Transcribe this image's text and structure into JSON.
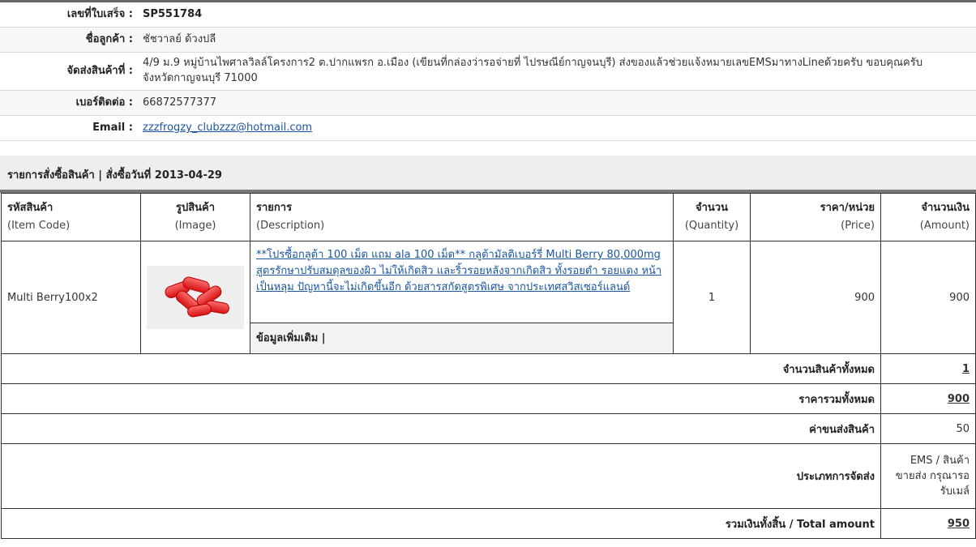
{
  "info": {
    "receipt_label": "เลขที่ใบเสร็จ :",
    "receipt_value": "SP551784",
    "customer_label": "ชื่อลูกค้า :",
    "customer_value": "ชัชวาลย์  ด้วงปลี",
    "address_label": "จัดส่งสินค้าที่ :",
    "address_line1": "4/9 ม.9 หมู่บ้านไพศาลวิลล์โครงการ2 ต.ปากแพรก อ.เมือง (เขียนที่กล่องว่ารอจ่ายที่ ไปรษณีย์กาญจนบุรี) ส่งของแล้วช่วยแจ้งหมายเลขEMSมาทางLineด้วยครับ ขอบคุณครับ",
    "address_line2": "จังหวัดกาญจนบุรี 71000",
    "phone_label": "เบอร์ติดต่อ :",
    "phone_value": "66872577377",
    "email_label": "Email :",
    "email_value": "zzzfrogzy_clubzzz@hotmail.com"
  },
  "order": {
    "header": "รายการสั่งซื้อสินค้า | สั่งซื้อวันที่ 2013-04-29"
  },
  "table": {
    "headers": [
      {
        "th": "รหัสสินค้า",
        "en": "(Item Code)"
      },
      {
        "th": "รูปสินค้า",
        "en": "(Image)"
      },
      {
        "th": "รายการ",
        "en": "(Description)"
      },
      {
        "th": "จำนวน",
        "en": "(Quantity)"
      },
      {
        "th": "ราคา/หน่วย",
        "en": "(Price)"
      },
      {
        "th": "จำนวนเงิน",
        "en": "(Amount)"
      }
    ],
    "row": {
      "code": "Multi Berry100x2",
      "description": "**โปรซื้อกลูต้า 100 เม็ด แถม ala 100 เม็ด** กลูต้ามัลติเบอร์รี่ Multi Berry 80,000mg สูตรรักษาปรับสมดุลของผิว ไม่ให้เกิดสิว และริ้วรอยหลังจากเกิดสิว ทั้งรอยดำ รอยแดง หน้าเป็นหลุม ปัญหานี้จะไม่เกิดขึ้นอีก ด้วยสารสกัดสูตรพิเศษ จากประเทศสวิสเซอร์แลนด์",
      "more_info": "ข้อมูลเพิ่มเติม |",
      "quantity": "1",
      "price": "900",
      "amount": "900"
    }
  },
  "summary": {
    "total_qty_label": "จำนวนสินค้าทั้งหมด",
    "total_qty": "1",
    "total_price_label": "ราคารวมทั้งหมด",
    "total_price": "900",
    "shipping_label": "ค่าขนส่งสินค้า",
    "shipping": "50",
    "ship_type_label": "ประเภทการจัดส่ง",
    "ship_type": "EMS / สินค้าขายส่ง กรุณารอรับเมล์",
    "grand_total_label": "รวมเงินทั้งสิ้น / Total amount",
    "grand_total": "950"
  },
  "colors": {
    "link": "#1a55a0",
    "pill": "#d41414"
  }
}
